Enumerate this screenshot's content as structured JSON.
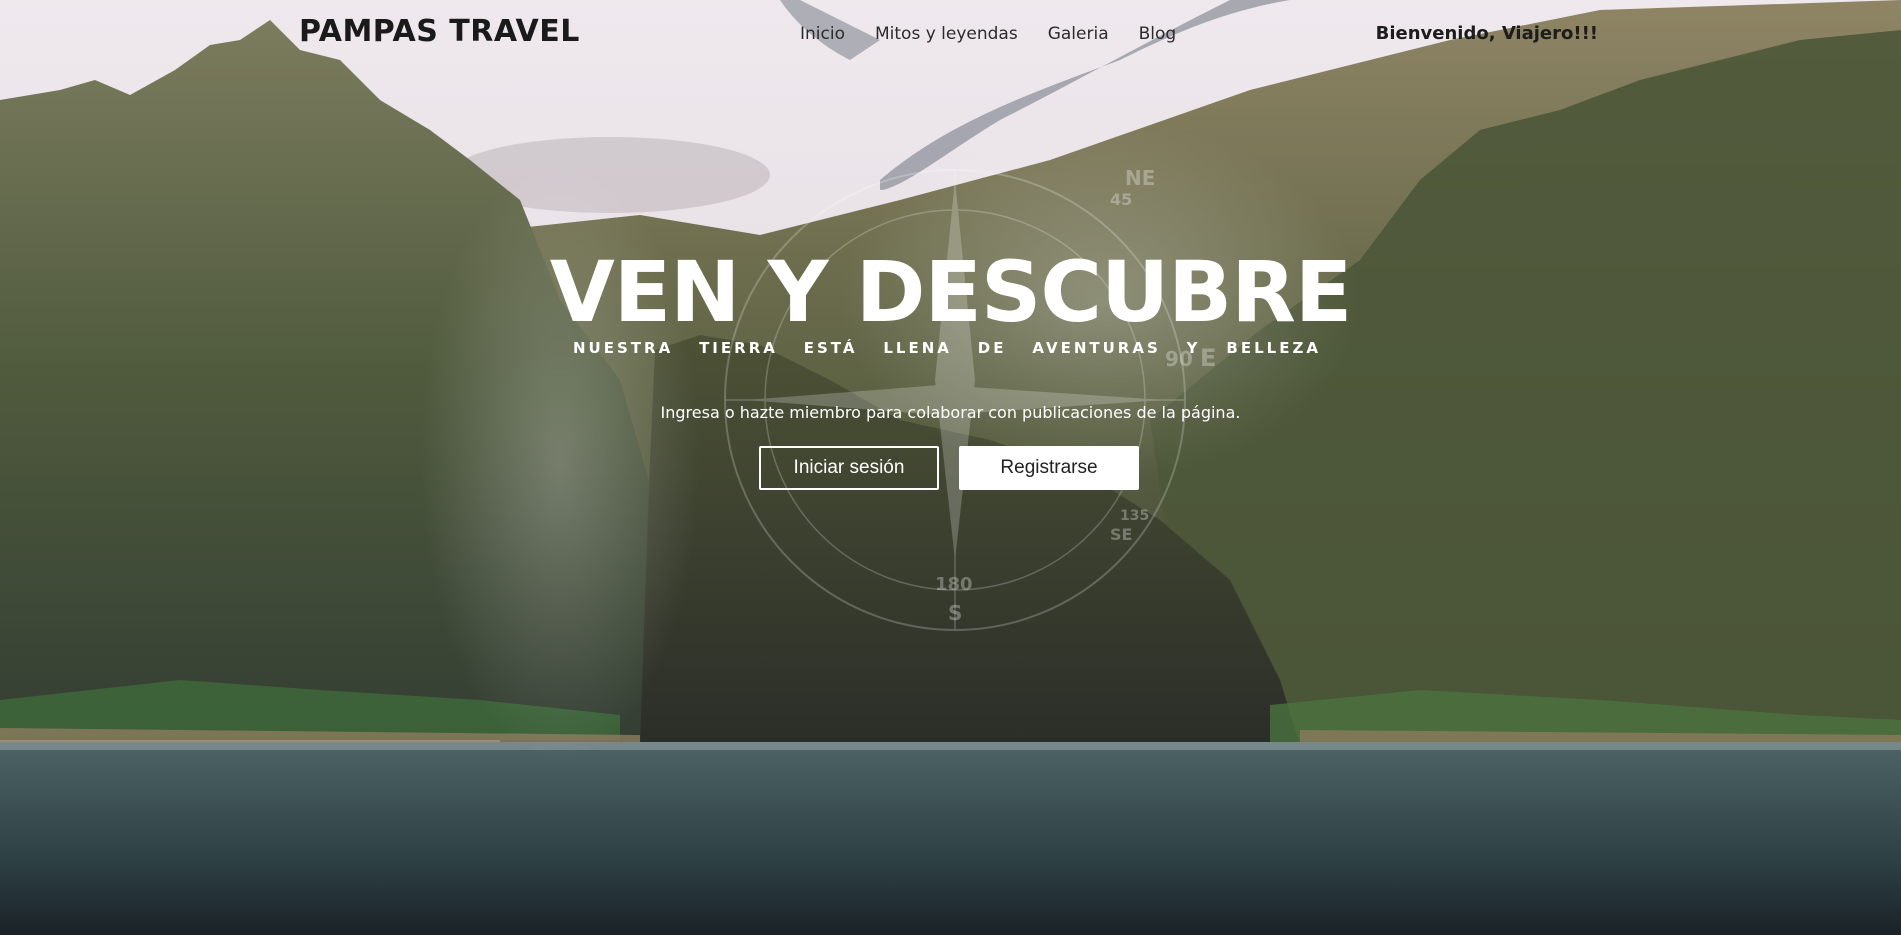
{
  "brand": "PAMPAS TRAVEL",
  "nav": {
    "items": [
      {
        "label": "Inicio"
      },
      {
        "label": "Mitos y leyendas"
      },
      {
        "label": "Galeria"
      },
      {
        "label": "Blog"
      }
    ],
    "welcome": "Bienvenido, Viajero!!!"
  },
  "hero": {
    "headline": "VEN Y DESCUBRE",
    "tagline_words": [
      "NUESTRA",
      "TIERRA",
      "ESTÁ",
      "LLENA",
      "DE",
      "AVENTURAS",
      "Y",
      "BELLEZA"
    ],
    "subtext": "Ingresa o hazte miembro para colaborar con publicaciones de la página.",
    "login_label": "Iniciar sesión",
    "register_label": "Registrarse",
    "compass_marks": [
      "NE",
      "45",
      "90",
      "E",
      "180",
      "S",
      "SE",
      "135"
    ]
  },
  "colors": {
    "text_dark": "#1a1a1a",
    "text_light": "#ffffff",
    "sky": "#ded7dc",
    "mountain": "#4a5a3a",
    "sea": "#2f4448"
  }
}
